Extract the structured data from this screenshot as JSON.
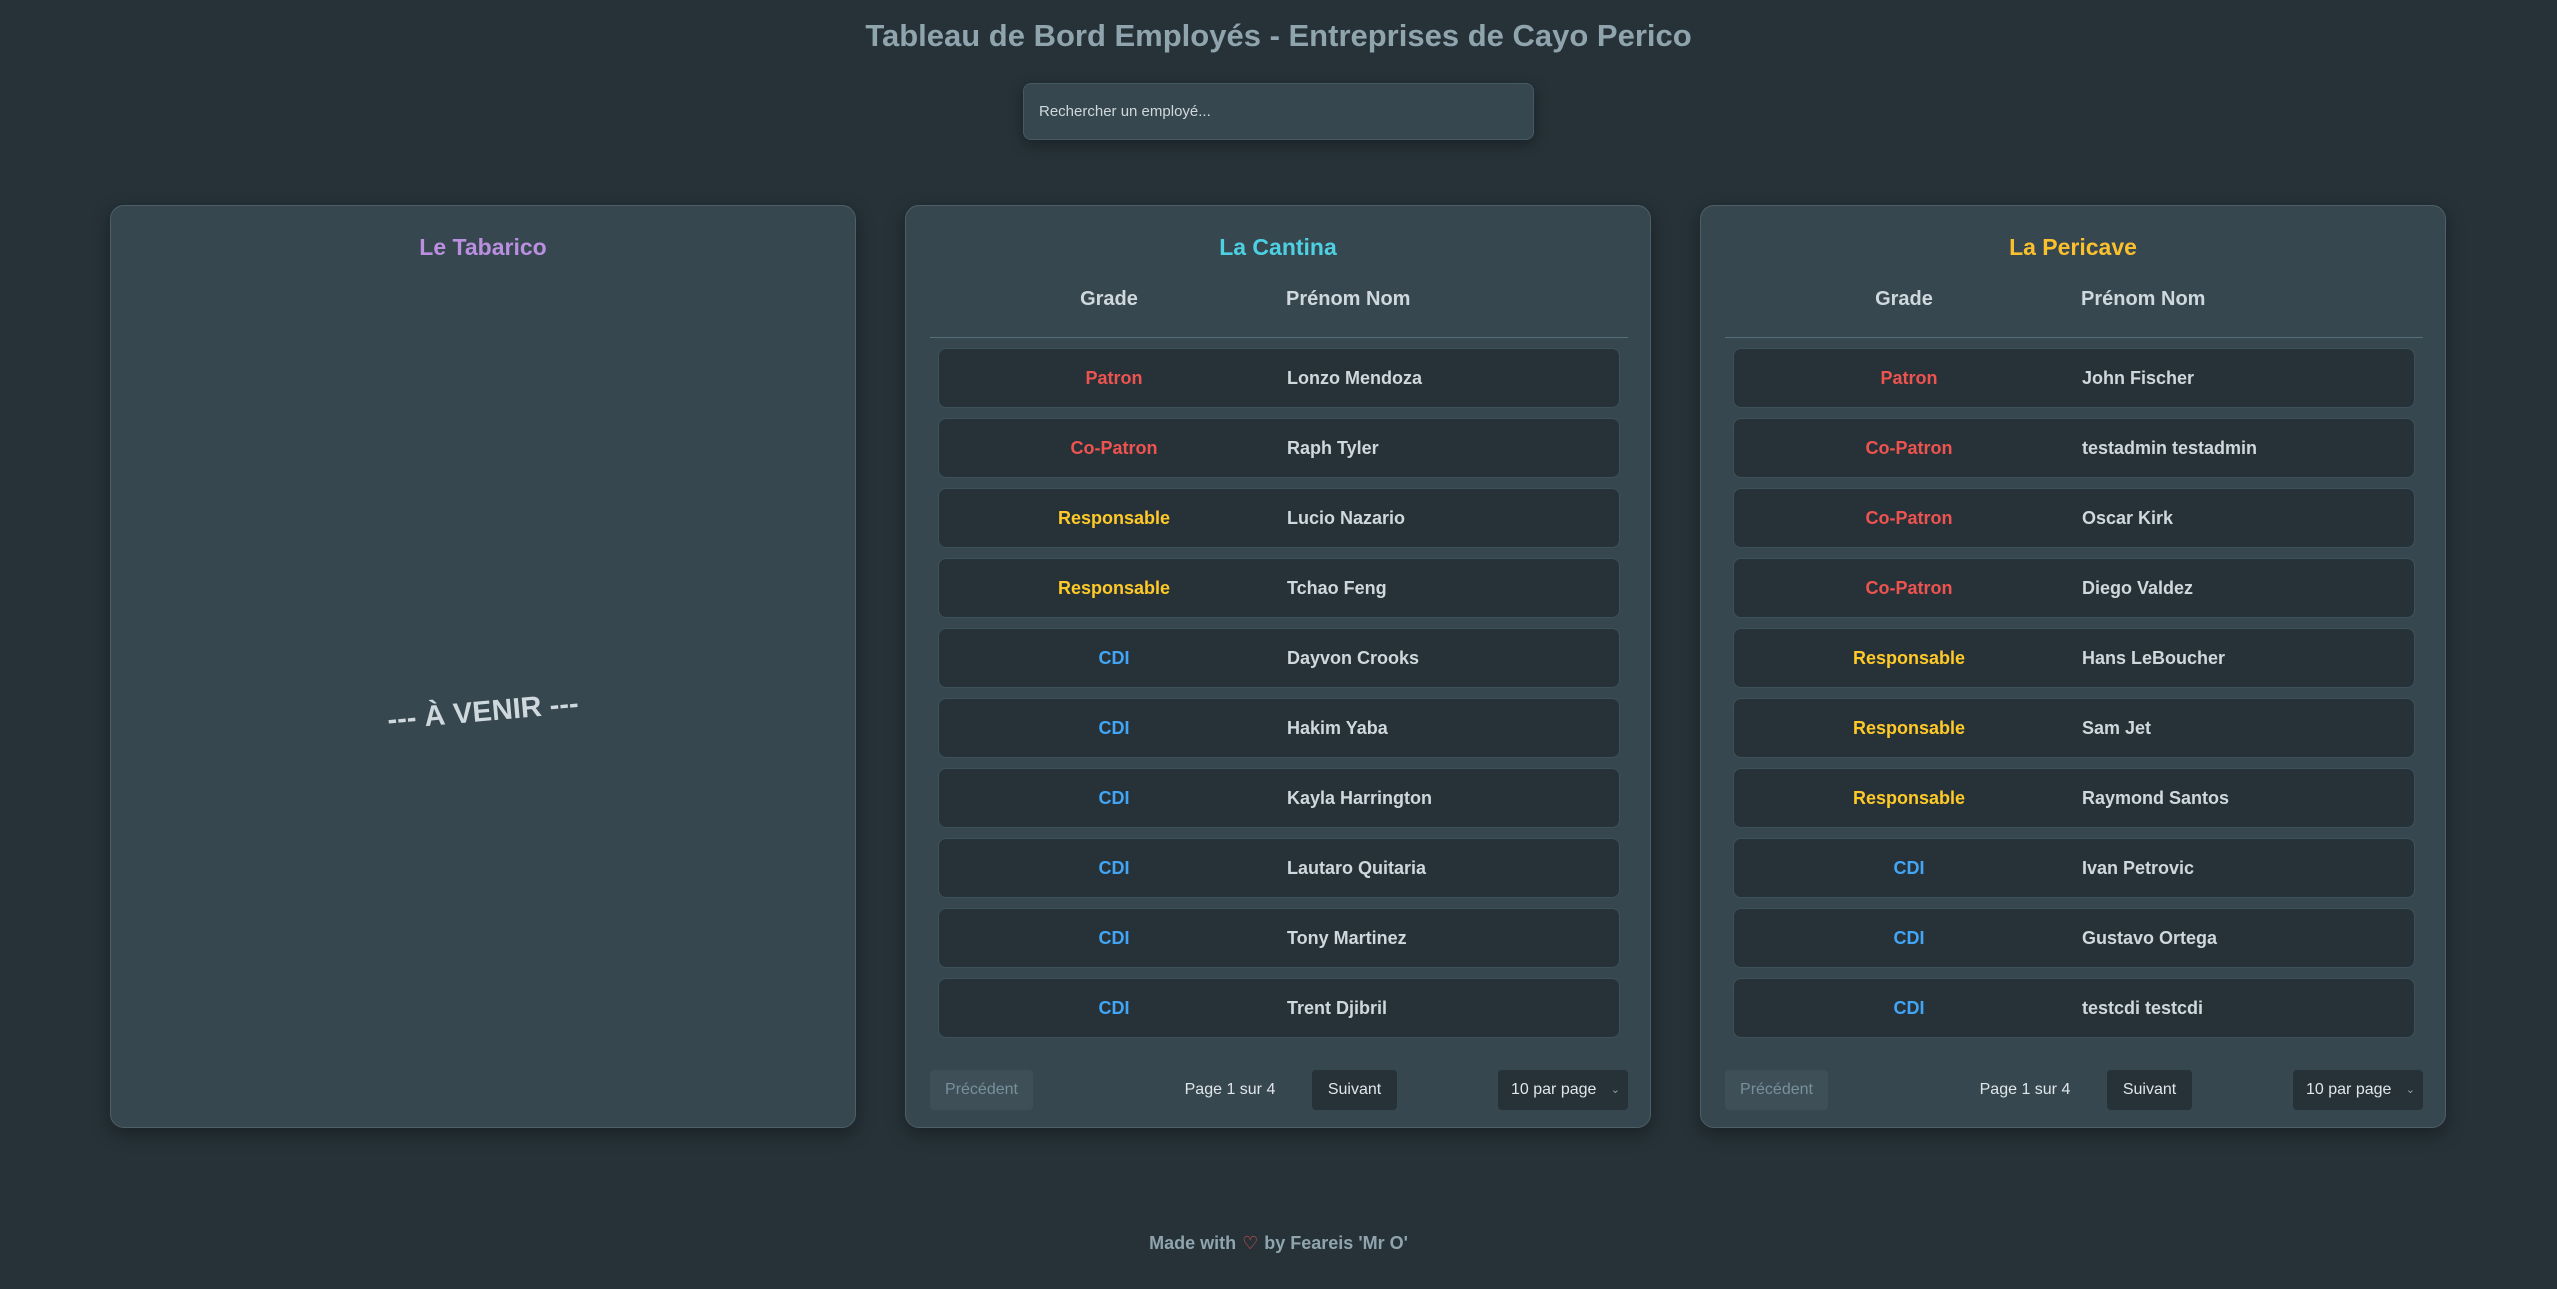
{
  "header": {
    "title": "Tableau de Bord Employés - Entreprises de Cayo Perico"
  },
  "search": {
    "placeholder": "Rechercher un employé...",
    "value": ""
  },
  "colors": {
    "tabarico": "#ba8fe0",
    "cantina": "#4dd0e1",
    "pericave": "#fbc02d",
    "patron": "#ef5350",
    "responsable": "#ffca28",
    "cdi": "#42a5f5"
  },
  "panels": {
    "tabarico": {
      "title": "Le Tabarico",
      "coming_soon": "--- À VENIR ---"
    },
    "cantina": {
      "title": "La Cantina",
      "columns": {
        "grade": "Grade",
        "name": "Prénom Nom"
      },
      "rows": [
        {
          "grade": "Patron",
          "name": "Lonzo Mendoza"
        },
        {
          "grade": "Co-Patron",
          "name": "Raph Tyler"
        },
        {
          "grade": "Responsable",
          "name": "Lucio Nazario"
        },
        {
          "grade": "Responsable",
          "name": "Tchao Feng"
        },
        {
          "grade": "CDI",
          "name": "Dayvon Crooks"
        },
        {
          "grade": "CDI",
          "name": "Hakim Yaba"
        },
        {
          "grade": "CDI",
          "name": "Kayla Harrington"
        },
        {
          "grade": "CDI",
          "name": "Lautaro Quitaria"
        },
        {
          "grade": "CDI",
          "name": "Tony Martinez"
        },
        {
          "grade": "CDI",
          "name": "Trent Djibril"
        }
      ],
      "pagination": {
        "prev_label": "Précédent",
        "page_info": "Page 1 sur 4",
        "next_label": "Suivant",
        "per_page": "10 par page"
      }
    },
    "pericave": {
      "title": "La Pericave",
      "columns": {
        "grade": "Grade",
        "name": "Prénom Nom"
      },
      "rows": [
        {
          "grade": "Patron",
          "name": "John Fischer"
        },
        {
          "grade": "Co-Patron",
          "name": "testadmin testadmin"
        },
        {
          "grade": "Co-Patron",
          "name": "Oscar Kirk"
        },
        {
          "grade": "Co-Patron",
          "name": "Diego Valdez"
        },
        {
          "grade": "Responsable",
          "name": "Hans LeBoucher"
        },
        {
          "grade": "Responsable",
          "name": "Sam Jet"
        },
        {
          "grade": "Responsable",
          "name": "Raymond Santos"
        },
        {
          "grade": "CDI",
          "name": "Ivan Petrovic"
        },
        {
          "grade": "CDI",
          "name": "Gustavo Ortega"
        },
        {
          "grade": "CDI",
          "name": "testcdi testcdi"
        }
      ],
      "pagination": {
        "prev_label": "Précédent",
        "page_info": "Page 1 sur 4",
        "next_label": "Suivant",
        "per_page": "10 par page"
      }
    }
  },
  "footer": {
    "made_with": "Made with",
    "heart_icon": "heart-icon",
    "heart": "♡",
    "by": "by Feareis 'Mr O'"
  }
}
